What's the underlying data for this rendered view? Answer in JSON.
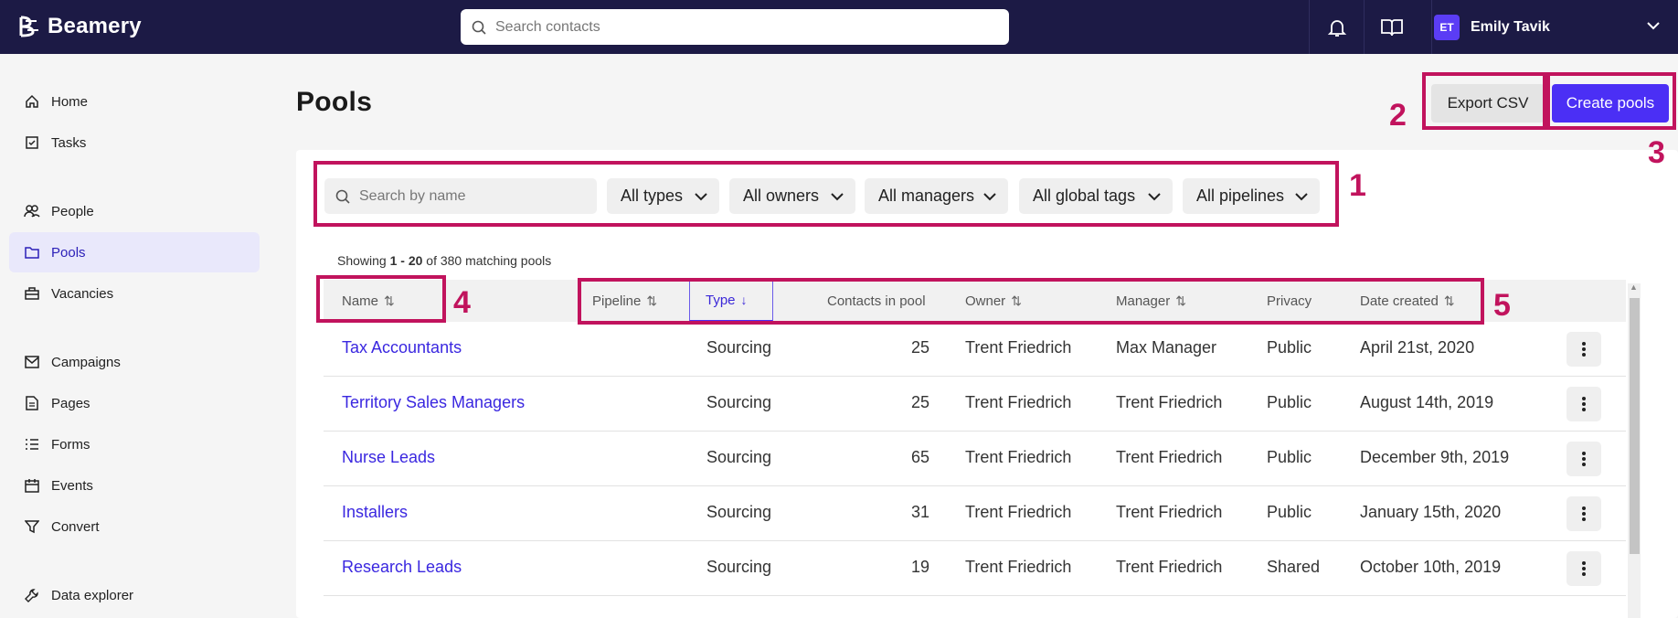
{
  "app": {
    "name": "Beamery"
  },
  "topbar": {
    "search_placeholder": "Search contacts",
    "user": {
      "initials": "ET",
      "name": "Emily Tavik"
    },
    "icons": [
      "bell-icon",
      "book-icon",
      "chevron-down-icon"
    ]
  },
  "sidebar": {
    "items": [
      {
        "label": "Home",
        "icon": "home-icon"
      },
      {
        "label": "Tasks",
        "icon": "tasks-icon"
      },
      {
        "label": "People",
        "icon": "people-icon"
      },
      {
        "label": "Pools",
        "icon": "folder-icon",
        "active": true
      },
      {
        "label": "Vacancies",
        "icon": "briefcase-icon"
      },
      {
        "label": "Campaigns",
        "icon": "mail-icon"
      },
      {
        "label": "Pages",
        "icon": "page-icon"
      },
      {
        "label": "Forms",
        "icon": "list-icon"
      },
      {
        "label": "Events",
        "icon": "calendar-icon"
      },
      {
        "label": "Convert",
        "icon": "filter-icon"
      },
      {
        "label": "Data explorer",
        "icon": "wrench-icon"
      }
    ]
  },
  "page": {
    "title": "Pools",
    "export_label": "Export CSV",
    "create_label": "Create pools"
  },
  "filters": {
    "search_placeholder": "Search by name",
    "dropdowns": [
      "All types",
      "All owners",
      "All managers",
      "All global tags",
      "All pipelines"
    ]
  },
  "results": {
    "prefix": "Showing ",
    "range": "1 - 20",
    "suffix": " of 380 matching pools"
  },
  "table": {
    "columns": [
      "Name",
      "Pipeline",
      "Type",
      "Contacts in pool",
      "Owner",
      "Manager",
      "Privacy",
      "Date created"
    ],
    "rows": [
      {
        "name": "Tax Accountants",
        "type": "Sourcing",
        "contacts": "25",
        "owner": "Trent Friedrich",
        "manager": "Max Manager",
        "privacy": "Public",
        "date": "April 21st, 2020"
      },
      {
        "name": "Territory Sales Managers",
        "type": "Sourcing",
        "contacts": "25",
        "owner": "Trent Friedrich",
        "manager": "Trent Friedrich",
        "privacy": "Public",
        "date": "August 14th, 2019"
      },
      {
        "name": "Nurse Leads",
        "type": "Sourcing",
        "contacts": "65",
        "owner": "Trent Friedrich",
        "manager": "Trent Friedrich",
        "privacy": "Public",
        "date": "December 9th, 2019"
      },
      {
        "name": "Installers",
        "type": "Sourcing",
        "contacts": "31",
        "owner": "Trent Friedrich",
        "manager": "Trent Friedrich",
        "privacy": "Public",
        "date": "January 15th, 2020"
      },
      {
        "name": "Research Leads",
        "type": "Sourcing",
        "contacts": "19",
        "owner": "Trent Friedrich",
        "manager": "Trent Friedrich",
        "privacy": "Shared",
        "date": "October 10th, 2019"
      }
    ]
  },
  "annotations": [
    "1",
    "2",
    "3",
    "4",
    "5"
  ],
  "colors": {
    "topbar": "#1c1a45",
    "accent": "#4b2ff5",
    "annotation": "#c1135d",
    "link": "#3a27e0"
  }
}
